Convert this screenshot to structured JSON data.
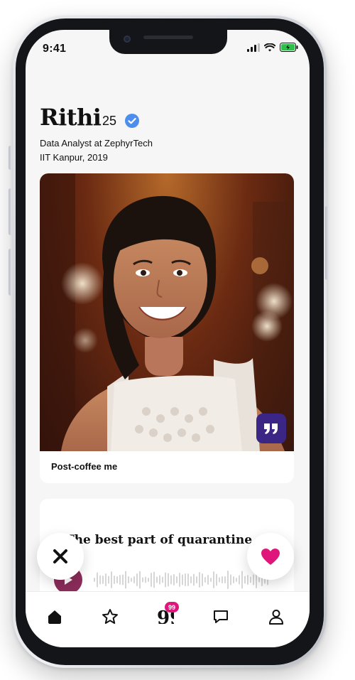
{
  "status_bar": {
    "time": "9:41"
  },
  "profile": {
    "name": "Rithi",
    "age": "25",
    "verified": true,
    "job": "Data Analyst at ZephyrTech",
    "education": "IIT Kanpur, 2019"
  },
  "photo_card": {
    "caption": "Post-coffee me"
  },
  "prompt_card": {
    "title": "The best part of quarantine"
  },
  "bottom_nav": {
    "items": [
      "home-icon",
      "star-icon",
      "quotes-icon",
      "chat-icon",
      "profile-icon"
    ],
    "badge": "99"
  },
  "colors": {
    "accent_pink": "#e0177a",
    "quote_purple": "#3b2685",
    "verified_blue": "#4a8ff0",
    "play_maroon": "#8b2c5a"
  }
}
